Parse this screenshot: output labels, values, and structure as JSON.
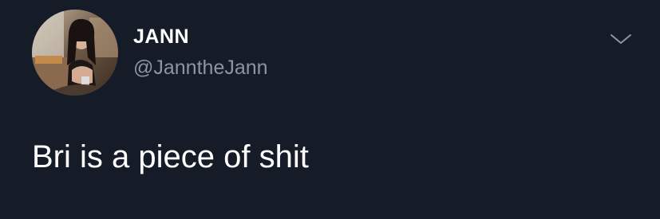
{
  "tweet": {
    "author": {
      "display_name": "JANN",
      "handle": "@JanntheJann",
      "avatar_icon": "profile-photo-avatar"
    },
    "text": "Bri is a piece of shit",
    "menu_icon": "chevron-down-icon"
  },
  "colors": {
    "background": "#151c27",
    "primary_text": "#ffffff",
    "secondary_text": "#8a96a3",
    "icon": "#8a96a3"
  }
}
